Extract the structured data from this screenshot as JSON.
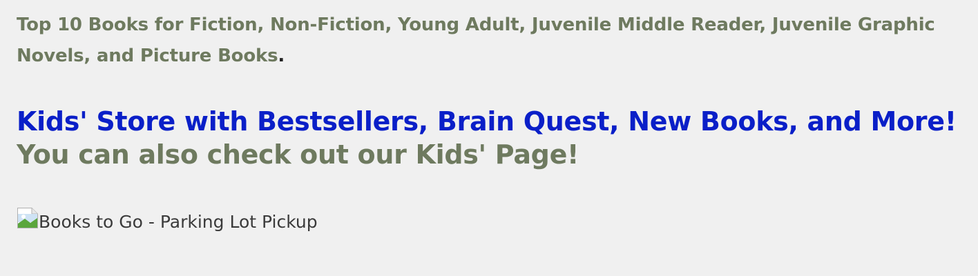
{
  "top10": {
    "link_text": "Top 10 Books for Fiction, Non-Fiction, Young Adult, Juvenile Middle Reader, Juvenile Graphic Novels, and Picture Books",
    "trailing_punct": "."
  },
  "kids_store": {
    "link_text": "Kids' Store with Bestsellers, Brain Quest, New Books, and More!"
  },
  "kids_page": {
    "text": "You can also check out our Kids' Page!"
  },
  "image": {
    "alt": "Books to Go - Parking Lot Pickup",
    "icon": "broken-image-icon"
  },
  "colors": {
    "background": "#f0f0f0",
    "olive_text": "#6e7a5f",
    "blue_link": "#0a1fc8",
    "alt_text": "#3a3a3a"
  }
}
